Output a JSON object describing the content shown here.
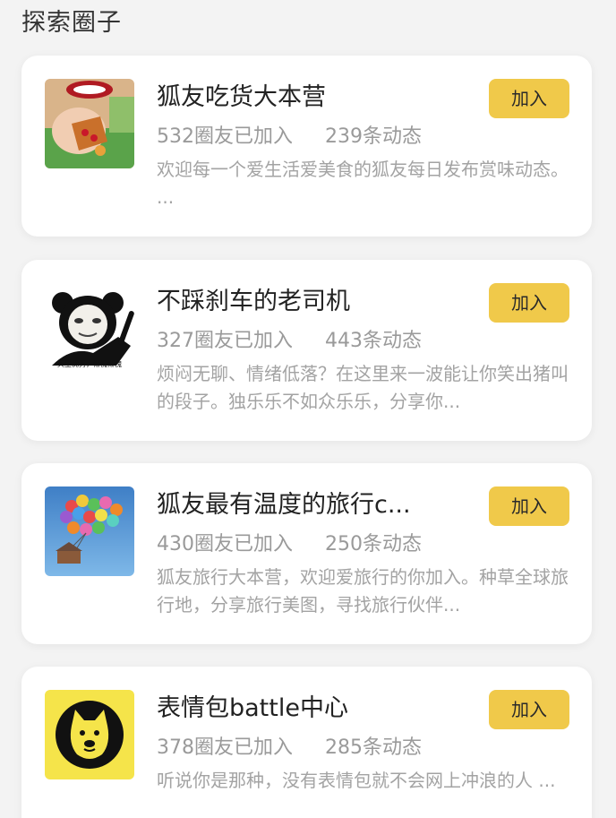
{
  "section_title": "探索圈子",
  "circles": [
    {
      "name": "狐友吃货大本营",
      "members": "532圈友已加入",
      "posts": "239条动态",
      "description": "欢迎每一个爱生活爱美食的狐友每日发布赏味动态。 ...",
      "join_label": "加入",
      "thumb_icon": "food-photo"
    },
    {
      "name": "不踩刹车的老司机",
      "members": "327圈友已加入",
      "posts": "443条动态",
      "description": "烦闷无聊、情绪低落？在这里来一波能让你笑出猪叫的段子。独乐乐不如众乐乐，分享你...",
      "join_label": "加入",
      "thumb_icon": "panda-meme",
      "thumb_caption": "天生优秀，惭愧惭愧"
    },
    {
      "name": "狐友最有温度的旅行c...",
      "members": "430圈友已加入",
      "posts": "250条动态",
      "description": "狐友旅行大本营，欢迎爱旅行的你加入。种草全球旅行地，分享旅行美图，寻找旅行伙伴...",
      "join_label": "加入",
      "thumb_icon": "balloon-house"
    },
    {
      "name": "表情包battle中心",
      "members": "378圈友已加入",
      "posts": "285条动态",
      "description": "听说你是那种，没有表情包就不会网上冲浪的人 ...",
      "join_label": "加入",
      "thumb_icon": "doge-logo"
    }
  ],
  "colors": {
    "join_button": "#f0c94a",
    "background": "#f3f3f3",
    "card": "#ffffff",
    "doge_bg": "#f5e44a"
  }
}
